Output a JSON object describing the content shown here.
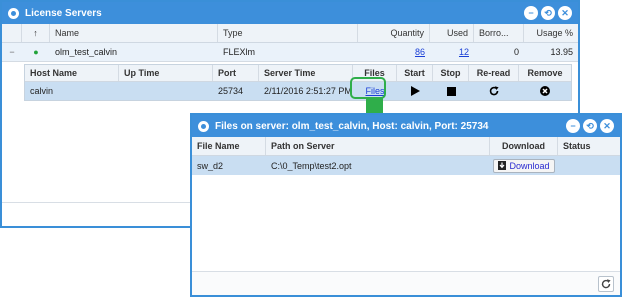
{
  "license_servers": {
    "title": "License Servers",
    "columns": [
      "↑",
      "Name",
      "Type",
      "Quantity",
      "Used",
      "Borro...",
      "Usage %"
    ],
    "server_row": {
      "expander": "−",
      "status_dot": "●",
      "name": "olm_test_calvin",
      "type": "FLEXlm",
      "quantity": "86",
      "used": "12",
      "borrowed": "0",
      "usage": "13.95"
    },
    "host_grid": {
      "columns": [
        "Host Name",
        "Up Time",
        "Port",
        "Server Time",
        "Files",
        "Start",
        "Stop",
        "Re-read",
        "Remove"
      ],
      "row": {
        "host": "calvin",
        "uptime": "",
        "port": "25734",
        "server_time": "2/11/2016 2:51:27 PM",
        "files": "Files"
      }
    }
  },
  "files_dialog": {
    "title": "Files on server: olm_test_calvin, Host: calvin, Port: 25734",
    "columns": [
      "File Name",
      "Path on Server",
      "Download",
      "Status"
    ],
    "rows": [
      {
        "file_name": "sw_d2",
        "path": "C:\\0_Temp\\test2.opt",
        "download_label": "Download"
      }
    ]
  },
  "window_buttons": {
    "minimize": "−",
    "restore": "⟲",
    "close": "✕"
  },
  "icons": {
    "start": "play-icon",
    "stop": "stop-icon",
    "reread": "refresh-icon",
    "remove": "remove-icon",
    "download": "download-icon",
    "refresh_footer": "refresh-icon"
  },
  "colors": {
    "accent": "#3d8fdb",
    "selected_row": "#c9def2",
    "highlight": "#2fae4a"
  }
}
